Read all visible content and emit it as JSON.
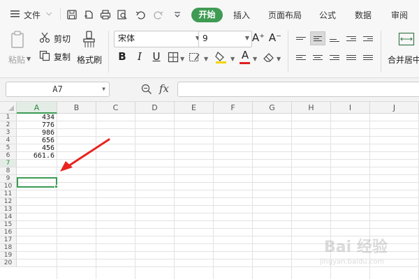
{
  "menu": {
    "file_label": "文件",
    "tabs": [
      "开始",
      "插入",
      "页面布局",
      "公式",
      "数据",
      "审阅"
    ]
  },
  "ribbon": {
    "paste_label": "粘贴",
    "cut_label": "剪切",
    "copy_label": "复制",
    "format_painter_label": "格式刷",
    "font_name": "宋体",
    "font_size": "9",
    "merge_center_label": "合并居中",
    "bold": "B",
    "italic": "I",
    "underline": "U",
    "font_color_glyph": "A",
    "grow_font": "A⁺",
    "shrink_font": "A⁻",
    "colors": {
      "accent": "#3f9b54",
      "font_color": "#e02020",
      "fill_color": "#f5d400"
    }
  },
  "formula_bar": {
    "name_box": "A7",
    "fx_label": "fx",
    "formula_value": ""
  },
  "sheet": {
    "columns": [
      "A",
      "B",
      "C",
      "D",
      "E",
      "F",
      "G",
      "H",
      "I",
      "J"
    ],
    "rows": [
      "1",
      "2",
      "3",
      "4",
      "5",
      "6",
      "7",
      "8",
      "9",
      "10",
      "11",
      "12",
      "13",
      "14",
      "15",
      "16",
      "17",
      "18",
      "19",
      "20"
    ],
    "selected_column": "A",
    "selected_row": "7",
    "column_a_values": [
      "434",
      "776",
      "986",
      "656",
      "456",
      "661.6"
    ]
  },
  "annotation": {
    "arrow_color": "#e8231f"
  },
  "watermark": {
    "text": "Bai 经验",
    "subtext": "jingyan.baidu.com"
  }
}
